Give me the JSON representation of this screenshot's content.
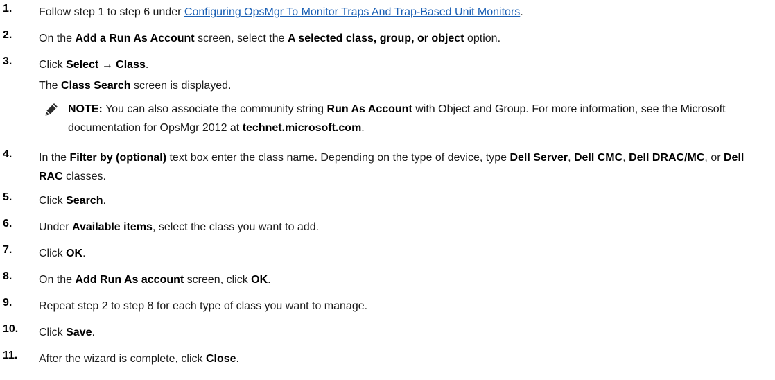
{
  "steps": [
    {
      "num": "1.",
      "parts": [
        {
          "t": "Follow step 1 to step 6 under "
        },
        {
          "t": "Configuring OpsMgr To Monitor Traps And Trap-Based Unit Monitors",
          "link": true
        },
        {
          "t": "."
        }
      ]
    },
    {
      "num": "2.",
      "parts": [
        {
          "t": "On the "
        },
        {
          "t": "Add a Run As Account",
          "b": true
        },
        {
          "t": " screen, select the "
        },
        {
          "t": "A selected class, group, or object",
          "b": true
        },
        {
          "t": " option."
        }
      ]
    },
    {
      "num": "3.",
      "parts": [
        {
          "t": "Click "
        },
        {
          "t": "Select → Class",
          "b": true
        },
        {
          "t": "."
        }
      ]
    },
    {
      "num": "4.",
      "parts": [
        {
          "t": "In the "
        },
        {
          "t": "Filter by (optional)",
          "b": true
        },
        {
          "t": " text box enter the class name. Depending on the type of device, type "
        },
        {
          "t": "Dell Server",
          "b": true
        },
        {
          "t": ", "
        },
        {
          "t": "Dell CMC",
          "b": true
        },
        {
          "t": ", "
        },
        {
          "t": "Dell DRAC/MC",
          "b": true
        },
        {
          "t": ", or "
        },
        {
          "t": "Dell RAC",
          "b": true
        },
        {
          "t": " classes."
        }
      ]
    },
    {
      "num": "5.",
      "parts": [
        {
          "t": "Click "
        },
        {
          "t": "Search",
          "b": true
        },
        {
          "t": "."
        }
      ]
    },
    {
      "num": "6.",
      "parts": [
        {
          "t": "Under "
        },
        {
          "t": "Available items",
          "b": true
        },
        {
          "t": ", select the class you want to add."
        }
      ]
    },
    {
      "num": "7.",
      "parts": [
        {
          "t": "Click "
        },
        {
          "t": "OK",
          "b": true
        },
        {
          "t": "."
        }
      ]
    },
    {
      "num": "8.",
      "parts": [
        {
          "t": "On the "
        },
        {
          "t": "Add Run As account",
          "b": true
        },
        {
          "t": " screen, click "
        },
        {
          "t": "OK",
          "b": true
        },
        {
          "t": "."
        }
      ]
    },
    {
      "num": "9.",
      "parts": [
        {
          "t": "Repeat step 2 to step 8 for each type of class you want to manage."
        }
      ]
    },
    {
      "num": "10.",
      "parts": [
        {
          "t": "Click "
        },
        {
          "t": "Save",
          "b": true
        },
        {
          "t": "."
        }
      ]
    },
    {
      "num": "11.",
      "parts": [
        {
          "t": "After the wizard is complete, click "
        },
        {
          "t": "Close",
          "b": true
        },
        {
          "t": "."
        }
      ]
    }
  ],
  "step3_result": [
    {
      "t": "The "
    },
    {
      "t": "Class Search",
      "b": true
    },
    {
      "t": " screen is displayed."
    }
  ],
  "note": {
    "icon": "pencil-note-icon",
    "parts": [
      {
        "t": "NOTE:",
        "b": true
      },
      {
        "t": " You can also associate the community string "
      },
      {
        "t": "Run As Account",
        "b": true
      },
      {
        "t": " with Object and Group. For more information, see the Microsoft documentation for OpsMgr 2012 at "
      },
      {
        "t": "technet.microsoft.com",
        "b": true
      },
      {
        "t": "."
      }
    ]
  }
}
